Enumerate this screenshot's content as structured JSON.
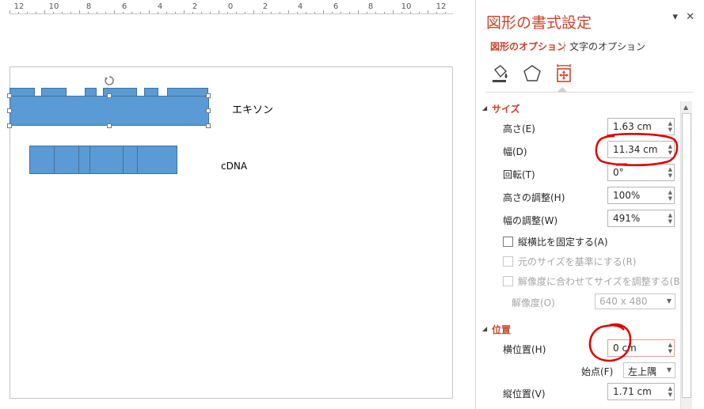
{
  "ruler": {
    "labels": [
      "12",
      "10",
      "8",
      "6",
      "4",
      "2",
      "0",
      "2",
      "4",
      "6",
      "8",
      "10",
      "12"
    ]
  },
  "slide": {
    "exon_label": "エキソン",
    "cdna_label": "cDNA"
  },
  "panel": {
    "title": "図形の書式設定",
    "tab_shape_options": "図形のオプション",
    "tab_text_options": "文字のオプション",
    "icons": [
      "fill-line-icon",
      "effects-pentagon-icon",
      "size-properties-icon"
    ],
    "size_section": {
      "title": "サイズ",
      "height_label": "高さ(E)",
      "height_value": "1.63 cm",
      "width_label": "幅(D)",
      "width_value": "11.34 cm",
      "rotation_label": "回転(T)",
      "rotation_value": "0°",
      "scale_height_label": "高さの調整(H)",
      "scale_height_value": "100%",
      "scale_width_label": "幅の調整(W)",
      "scale_width_value": "491%",
      "lock_aspect_label": "縦横比を固定する(A)",
      "relative_original_label": "元のサイズを基準にする(R)",
      "best_scale_label": "解像度に合わせてサイズを調整する(B)",
      "resolution_label": "解像度(O)",
      "resolution_value": "640 x 480"
    },
    "position_section": {
      "title": "位置",
      "horizontal_label": "横位置(H)",
      "horizontal_value": "0 cm",
      "from_label": "始点(F)",
      "from_value": "左上隅",
      "vertical_label": "縦位置(V)",
      "vertical_value": "1.71 cm"
    }
  },
  "colors": {
    "accent": "#c5462c",
    "shape_fill": "#5b9bd5",
    "shape_border": "#41719c",
    "annotation": "#e00000"
  }
}
